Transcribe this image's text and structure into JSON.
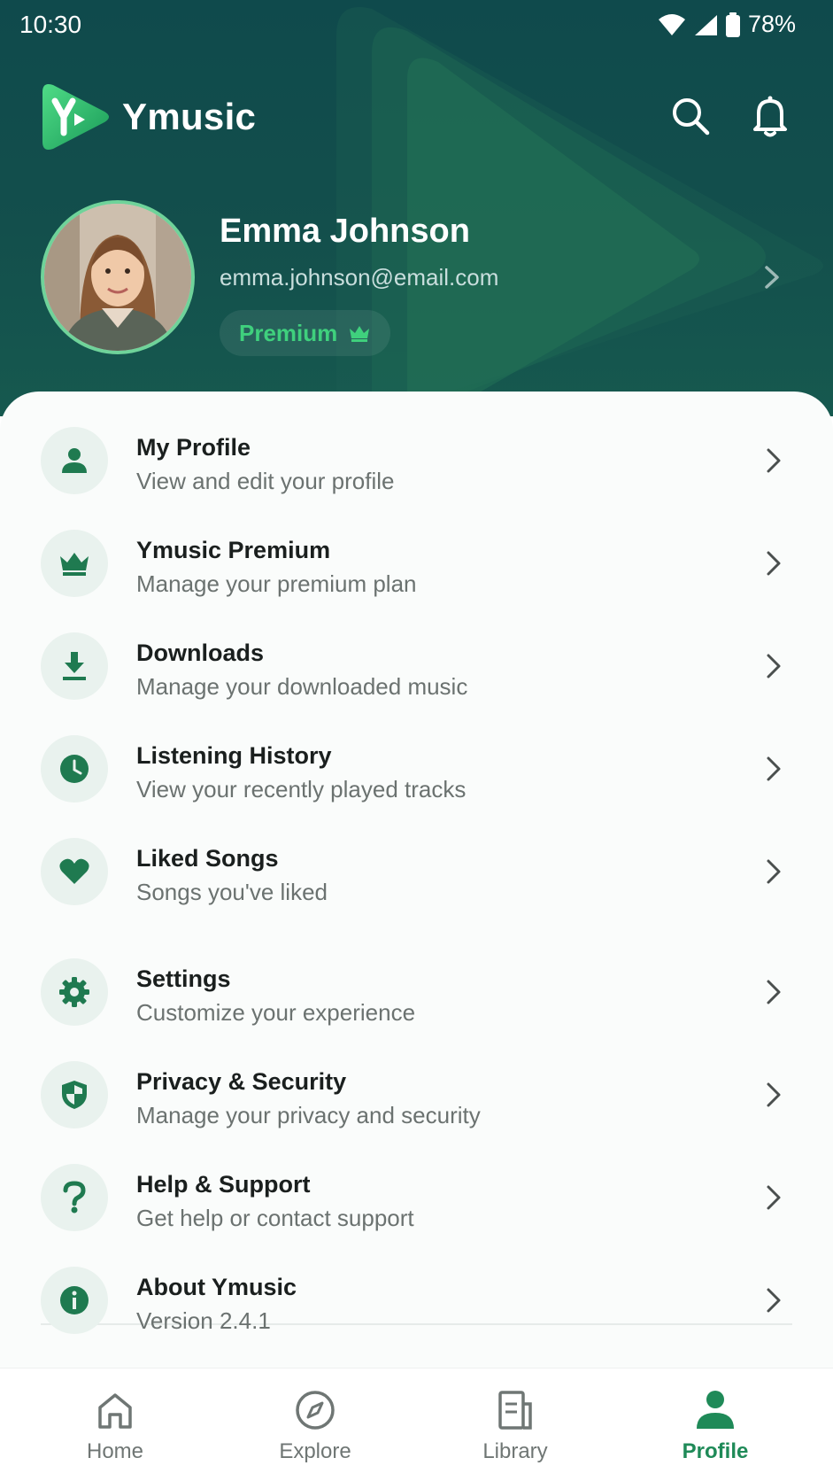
{
  "status": {
    "time": "10:30",
    "battery": "78%"
  },
  "brand": {
    "name": "Ymusic",
    "accent": "#2fbf6f"
  },
  "profile": {
    "name": "Emma Johnson",
    "email": "emma.johnson@email.com",
    "badge": "Premium"
  },
  "menu": [
    {
      "title": "My Profile",
      "subtitle": "View and edit your profile",
      "icon": "person-icon"
    },
    {
      "title": "Ymusic Premium",
      "subtitle": "Manage your premium plan",
      "icon": "crown-icon"
    },
    {
      "title": "Downloads",
      "subtitle": "Manage your downloaded music",
      "icon": "download-icon"
    },
    {
      "title": "Listening History",
      "subtitle": "View your recently played tracks",
      "icon": "clock-icon"
    },
    {
      "title": "Liked Songs",
      "subtitle": "Songs you've liked",
      "icon": "heart-icon"
    },
    {
      "title": "Settings",
      "subtitle": "Customize your experience",
      "icon": "gear-icon"
    },
    {
      "title": "Privacy & Security",
      "subtitle": "Manage your privacy and security",
      "icon": "shield-icon"
    },
    {
      "title": "Help & Support",
      "subtitle": "Get help or contact support",
      "icon": "question-icon"
    },
    {
      "title": "About Ymusic",
      "subtitle": "Version 2.4.1",
      "icon": "info-icon"
    }
  ],
  "nav": [
    {
      "label": "Home",
      "icon": "home-icon"
    },
    {
      "label": "Explore",
      "icon": "compass-icon"
    },
    {
      "label": "Library",
      "icon": "library-icon"
    },
    {
      "label": "Profile",
      "icon": "profile-icon",
      "active": true
    }
  ],
  "colors": {
    "header": "#134f4c",
    "primary": "#1f7a50",
    "badge_text": "#3fd07d"
  }
}
